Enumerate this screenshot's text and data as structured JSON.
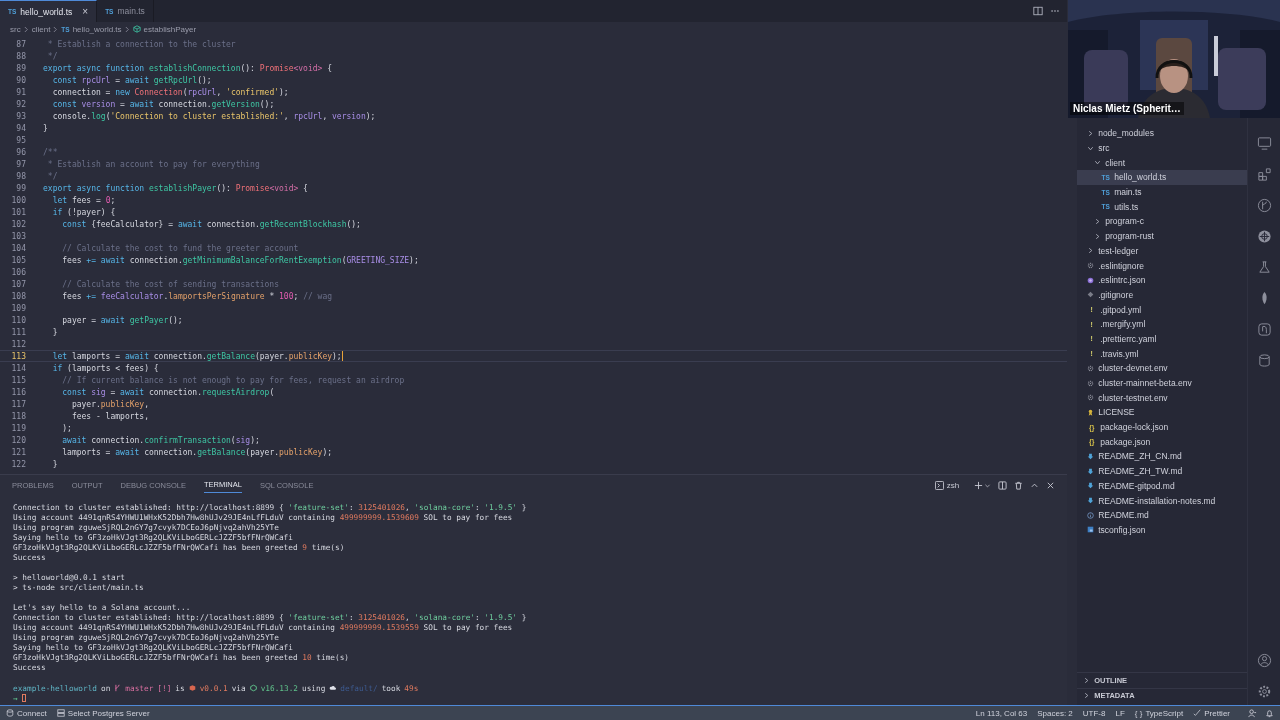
{
  "editor_tabs": [
    {
      "glyph": "TS",
      "label": "hello_world.ts",
      "selected": true,
      "close": "×"
    },
    {
      "glyph": "TS",
      "label": "main.ts",
      "selected": false
    }
  ],
  "breadcrumb": [
    {
      "kind": "folder",
      "text": "src"
    },
    {
      "kind": "folder",
      "text": "client"
    },
    {
      "kind": "file",
      "glyph": "TS",
      "text": "hello_world.ts"
    },
    {
      "kind": "symbol",
      "text": "establishPayer"
    }
  ],
  "code": [
    {
      "number": "87",
      "current": false,
      "tokens": [
        {
          "kind": "cm",
          "text": " * Establish a connection to the cluster"
        }
      ]
    },
    {
      "number": "88",
      "current": false,
      "tokens": [
        {
          "kind": "cm",
          "text": " */"
        }
      ]
    },
    {
      "number": "89",
      "current": false,
      "tokens": [
        {
          "kind": "kw",
          "text": "export async function "
        },
        {
          "kind": "fn",
          "text": "establishConnection"
        },
        {
          "kind": "plain",
          "text": "(): "
        },
        {
          "kind": "cls",
          "text": "Promise"
        },
        {
          "kind": "type",
          "text": "<void>"
        },
        {
          "kind": "plain",
          "text": " {"
        }
      ]
    },
    {
      "number": "90",
      "current": false,
      "tokens": [
        {
          "kind": "kw",
          "text": "  const "
        },
        {
          "kind": "var",
          "text": "rpcUrl"
        },
        {
          "kind": "plain",
          "text": " = "
        },
        {
          "kind": "kw",
          "text": "await "
        },
        {
          "kind": "fn",
          "text": "getRpcUrl"
        },
        {
          "kind": "plain",
          "text": "();"
        }
      ]
    },
    {
      "number": "91",
      "current": false,
      "tokens": [
        {
          "kind": "plain",
          "text": "  connection = "
        },
        {
          "kind": "kw",
          "text": "new "
        },
        {
          "kind": "cls",
          "text": "Connection"
        },
        {
          "kind": "plain",
          "text": "("
        },
        {
          "kind": "var",
          "text": "rpcUrl"
        },
        {
          "kind": "plain",
          "text": ", "
        },
        {
          "kind": "str",
          "text": "'confirmed'"
        },
        {
          "kind": "plain",
          "text": ");"
        }
      ]
    },
    {
      "number": "92",
      "current": false,
      "tokens": [
        {
          "kind": "kw",
          "text": "  const "
        },
        {
          "kind": "var",
          "text": "version"
        },
        {
          "kind": "plain",
          "text": " = "
        },
        {
          "kind": "kw",
          "text": "await "
        },
        {
          "kind": "plain",
          "text": "connection."
        },
        {
          "kind": "fn",
          "text": "getVersion"
        },
        {
          "kind": "plain",
          "text": "();"
        }
      ]
    },
    {
      "number": "93",
      "current": false,
      "tokens": [
        {
          "kind": "plain",
          "text": "  console."
        },
        {
          "kind": "fn",
          "text": "log"
        },
        {
          "kind": "plain",
          "text": "("
        },
        {
          "kind": "str",
          "text": "'Connection to cluster established:'"
        },
        {
          "kind": "plain",
          "text": ", "
        },
        {
          "kind": "var",
          "text": "rpcUrl"
        },
        {
          "kind": "plain",
          "text": ", "
        },
        {
          "kind": "var",
          "text": "version"
        },
        {
          "kind": "plain",
          "text": ");"
        }
      ]
    },
    {
      "number": "94",
      "current": false,
      "tokens": [
        {
          "kind": "plain",
          "text": "}"
        }
      ]
    },
    {
      "number": "95",
      "current": false
    },
    {
      "number": "96",
      "current": false,
      "tokens": [
        {
          "kind": "cm",
          "text": "/**"
        }
      ]
    },
    {
      "number": "97",
      "current": false,
      "tokens": [
        {
          "kind": "cm",
          "text": " * Establish an account to pay for everything"
        }
      ]
    },
    {
      "number": "98",
      "current": false,
      "tokens": [
        {
          "kind": "cm",
          "text": " */"
        }
      ]
    },
    {
      "number": "99",
      "current": false,
      "tokens": [
        {
          "kind": "kw",
          "text": "export async function "
        },
        {
          "kind": "fn",
          "text": "establishPayer"
        },
        {
          "kind": "plain",
          "text": "(): "
        },
        {
          "kind": "cls",
          "text": "Promise"
        },
        {
          "kind": "type",
          "text": "<void>"
        },
        {
          "kind": "plain",
          "text": " {"
        }
      ]
    },
    {
      "number": "100",
      "current": false,
      "tokens": [
        {
          "kind": "kw",
          "text": "  let "
        },
        {
          "kind": "plain",
          "text": "fees = "
        },
        {
          "kind": "num",
          "text": "0"
        },
        {
          "kind": "plain",
          "text": ";"
        }
      ]
    },
    {
      "number": "101",
      "current": false,
      "tokens": [
        {
          "kind": "kw",
          "text": "  if "
        },
        {
          "kind": "plain",
          "text": "(!payer) {"
        }
      ]
    },
    {
      "number": "102",
      "current": false,
      "tokens": [
        {
          "kind": "kw",
          "text": "    const "
        },
        {
          "kind": "plain",
          "text": "{feeCalculator} = "
        },
        {
          "kind": "kw",
          "text": "await "
        },
        {
          "kind": "plain",
          "text": "connection."
        },
        {
          "kind": "fn",
          "text": "getRecentBlockhash"
        },
        {
          "kind": "plain",
          "text": "();"
        }
      ]
    },
    {
      "number": "103",
      "current": false
    },
    {
      "number": "104",
      "current": false,
      "tokens": [
        {
          "kind": "cm",
          "text": "    // Calculate the cost to fund the greeter account"
        }
      ]
    },
    {
      "number": "105",
      "current": false,
      "tokens": [
        {
          "kind": "plain",
          "text": "    fees "
        },
        {
          "kind": "kw",
          "text": "+= await "
        },
        {
          "kind": "plain",
          "text": "connection."
        },
        {
          "kind": "fn",
          "text": "getMinimumBalanceForRentExemption"
        },
        {
          "kind": "plain",
          "text": "("
        },
        {
          "kind": "var",
          "text": "GREETING_SIZE"
        },
        {
          "kind": "plain",
          "text": ");"
        }
      ]
    },
    {
      "number": "106",
      "current": false
    },
    {
      "number": "107",
      "current": false,
      "tokens": [
        {
          "kind": "cm",
          "text": "    // Calculate the cost of sending transactions"
        }
      ]
    },
    {
      "number": "108",
      "current": false,
      "tokens": [
        {
          "kind": "plain",
          "text": "    fees "
        },
        {
          "kind": "kw",
          "text": "+= "
        },
        {
          "kind": "var",
          "text": "feeCalculator"
        },
        {
          "kind": "plain",
          "text": "."
        },
        {
          "kind": "prop",
          "text": "lamportsPerSignature"
        },
        {
          "kind": "plain",
          "text": " * "
        },
        {
          "kind": "num",
          "text": "100"
        },
        {
          "kind": "plain",
          "text": "; "
        },
        {
          "kind": "cm",
          "text": "// wag"
        }
      ]
    },
    {
      "number": "109",
      "current": false
    },
    {
      "number": "110",
      "current": false,
      "tokens": [
        {
          "kind": "plain",
          "text": "    payer = "
        },
        {
          "kind": "kw",
          "text": "await "
        },
        {
          "kind": "fn",
          "text": "getPayer"
        },
        {
          "kind": "plain",
          "text": "();"
        }
      ]
    },
    {
      "number": "111",
      "current": false,
      "tokens": [
        {
          "kind": "plain",
          "text": "  }"
        }
      ]
    },
    {
      "number": "112",
      "current": false
    },
    {
      "number": "113",
      "current": true,
      "tokens": [
        {
          "kind": "kw",
          "text": "  let "
        },
        {
          "kind": "plain",
          "text": "lamports = "
        },
        {
          "kind": "kw",
          "text": "await "
        },
        {
          "kind": "plain",
          "text": "connection."
        },
        {
          "kind": "fn",
          "text": "getBalance"
        },
        {
          "kind": "plain",
          "text": "(payer."
        },
        {
          "kind": "prop",
          "text": "publicKey"
        },
        {
          "kind": "plain",
          "text": ");"
        }
      ]
    },
    {
      "number": "114",
      "current": false,
      "tokens": [
        {
          "kind": "kw",
          "text": "  if "
        },
        {
          "kind": "plain",
          "text": "(lamports < fees) {"
        }
      ]
    },
    {
      "number": "115",
      "current": false,
      "tokens": [
        {
          "kind": "cm",
          "text": "    // If current balance is not enough to pay for fees, request an airdrop"
        }
      ]
    },
    {
      "number": "116",
      "current": false,
      "tokens": [
        {
          "kind": "kw",
          "text": "    const "
        },
        {
          "kind": "var",
          "text": "sig"
        },
        {
          "kind": "plain",
          "text": " = "
        },
        {
          "kind": "kw",
          "text": "await "
        },
        {
          "kind": "plain",
          "text": "connection."
        },
        {
          "kind": "fn",
          "text": "requestAirdrop"
        },
        {
          "kind": "plain",
          "text": "("
        }
      ]
    },
    {
      "number": "117",
      "current": false,
      "tokens": [
        {
          "kind": "plain",
          "text": "      payer."
        },
        {
          "kind": "prop",
          "text": "publicKey"
        },
        {
          "kind": "plain",
          "text": ","
        }
      ]
    },
    {
      "number": "118",
      "current": false,
      "tokens": [
        {
          "kind": "plain",
          "text": "      fees - lamports,"
        }
      ]
    },
    {
      "number": "119",
      "current": false,
      "tokens": [
        {
          "kind": "plain",
          "text": "    );"
        }
      ]
    },
    {
      "number": "120",
      "current": false,
      "tokens": [
        {
          "kind": "kw",
          "text": "    await "
        },
        {
          "kind": "plain",
          "text": "connection."
        },
        {
          "kind": "fn",
          "text": "confirmTransaction"
        },
        {
          "kind": "plain",
          "text": "("
        },
        {
          "kind": "var",
          "text": "sig"
        },
        {
          "kind": "plain",
          "text": ");"
        }
      ]
    },
    {
      "number": "121",
      "current": false,
      "tokens": [
        {
          "kind": "plain",
          "text": "    lamports = "
        },
        {
          "kind": "kw",
          "text": "await "
        },
        {
          "kind": "plain",
          "text": "connection."
        },
        {
          "kind": "fn",
          "text": "getBalance"
        },
        {
          "kind": "plain",
          "text": "(payer."
        },
        {
          "kind": "prop",
          "text": "publicKey"
        },
        {
          "kind": "plain",
          "text": ");"
        }
      ]
    },
    {
      "number": "122",
      "current": false,
      "tokens": [
        {
          "kind": "plain",
          "text": "  }"
        }
      ]
    }
  ],
  "panel": {
    "tabs": [
      {
        "label": "PROBLEMS",
        "selected": false
      },
      {
        "label": "OUTPUT",
        "selected": false
      },
      {
        "label": "DEBUG CONSOLE",
        "selected": false
      },
      {
        "label": "TERMINAL",
        "selected": true
      },
      {
        "label": "SQL CONSOLE",
        "selected": false
      }
    ],
    "shell": "zsh",
    "terminal_blocks": [
      {
        "lines": [
          {
            "tokens": [
              {
                "kind": "text",
                "text": "Connection to cluster established: http://localhost:8899 { "
              },
              {
                "kind": "string",
                "text": "'feature-set'"
              },
              {
                "kind": "text",
                "text": ": "
              },
              {
                "kind": "number",
                "text": "3125401026"
              },
              {
                "kind": "text",
                "text": ", "
              },
              {
                "kind": "string",
                "text": "'solana-core'"
              },
              {
                "kind": "text",
                "text": ": "
              },
              {
                "kind": "string",
                "text": "'1.9.5'"
              },
              {
                "kind": "text",
                "text": " }"
              }
            ]
          },
          {
            "tokens": [
              {
                "kind": "text",
                "text": "Using account 4491qnRS4YHWU1WHxK52Dbh7Hw8hUJv29JE4nLfFLduV containing "
              },
              {
                "kind": "number",
                "text": "499999999.1539609"
              },
              {
                "kind": "text",
                "text": " SOL to pay for fees"
              }
            ]
          },
          {
            "tokens": [
              {
                "kind": "text",
                "text": "Using program zguweSjRQL2nGY7g7cvyk7DCEoJ6pNjvq2ahVh25YTe"
              }
            ]
          },
          {
            "tokens": [
              {
                "kind": "text",
                "text": "Saying hello to GF3zoHkVJgt3Rg2QLKViLboGERLcJZZF5bfFNrQWCafi"
              }
            ]
          },
          {
            "tokens": [
              {
                "kind": "text",
                "text": "GF3zoHkVJgt3Rg2QLKViLboGERLcJZZF5bfFNrQWCafi has been greeted "
              },
              {
                "kind": "number",
                "text": "9"
              },
              {
                "kind": "text",
                "text": " time(s)"
              }
            ]
          },
          {
            "tokens": [
              {
                "kind": "text",
                "text": "Success"
              }
            ]
          }
        ]
      },
      {
        "lines": [
          {
            "tokens": [
              {
                "kind": "text",
                "text": "> helloworld@0.0.1 start"
              }
            ]
          },
          {
            "tokens": [
              {
                "kind": "text",
                "text": "> ts-node src/client/main.ts"
              }
            ]
          }
        ]
      },
      {
        "lines": [
          {
            "tokens": [
              {
                "kind": "text",
                "text": "Let's say hello to a Solana account..."
              }
            ]
          },
          {
            "tokens": [
              {
                "kind": "text",
                "text": "Connection to cluster established: http://localhost:8899 { "
              },
              {
                "kind": "string",
                "text": "'feature-set'"
              },
              {
                "kind": "text",
                "text": ": "
              },
              {
                "kind": "number",
                "text": "3125401026"
              },
              {
                "kind": "text",
                "text": ", "
              },
              {
                "kind": "string",
                "text": "'solana-core'"
              },
              {
                "kind": "text",
                "text": ": "
              },
              {
                "kind": "string",
                "text": "'1.9.5'"
              },
              {
                "kind": "text",
                "text": " }"
              }
            ]
          },
          {
            "tokens": [
              {
                "kind": "text",
                "text": "Using account 4491qnRS4YHWU1WHxK52Dbh7Hw8hUJv29JE4nLfFLduV containing "
              },
              {
                "kind": "number",
                "text": "499999999.1539559"
              },
              {
                "kind": "text",
                "text": " SOL to pay for fees"
              }
            ]
          },
          {
            "tokens": [
              {
                "kind": "text",
                "text": "Using program zguweSjRQL2nGY7g7cvyk7DCEoJ6pNjvq2ahVh25YTe"
              }
            ]
          },
          {
            "tokens": [
              {
                "kind": "text",
                "text": "Saying hello to GF3zoHkVJgt3Rg2QLKViLboGERLcJZZF5bfFNrQWCafi"
              }
            ]
          },
          {
            "tokens": [
              {
                "kind": "text",
                "text": "GF3zoHkVJgt3Rg2QLKViLboGERLcJZZF5bfFNrQWCafi has been greeted "
              },
              {
                "kind": "number",
                "text": "10"
              },
              {
                "kind": "text",
                "text": " time(s)"
              }
            ]
          },
          {
            "tokens": [
              {
                "kind": "text",
                "text": "Success"
              }
            ]
          }
        ]
      }
    ],
    "prompt": {
      "directory": "example-helloworld",
      "on": "on",
      "branch": "master",
      "branch_status": "[!]",
      "is": "is",
      "version": "v0.0.1",
      "via": "via",
      "node": "v16.13.2",
      "using": "using",
      "profile": "default/",
      "took": "took",
      "duration": "49s",
      "symbol": "→"
    }
  },
  "explorer": {
    "items": [
      {
        "kind": "folder",
        "name": "node_modules",
        "expanded": false,
        "selected": false
      },
      {
        "kind": "folder",
        "name": "src",
        "expanded": true,
        "selected": false,
        "children": [
          {
            "kind": "folder",
            "name": "client",
            "expanded": true,
            "selected": false,
            "children": [
              {
                "kind": "ts",
                "glyph": "TS",
                "name": "hello_world.ts",
                "selected": true
              },
              {
                "kind": "ts",
                "glyph": "TS",
                "name": "main.ts",
                "selected": false
              },
              {
                "kind": "ts",
                "glyph": "TS",
                "name": "utils.ts",
                "selected": false
              }
            ]
          },
          {
            "kind": "folder",
            "name": "program-c",
            "expanded": false,
            "selected": false
          },
          {
            "kind": "folder",
            "name": "program-rust",
            "expanded": false,
            "selected": false
          }
        ]
      },
      {
        "kind": "folder",
        "name": "test-ledger",
        "expanded": false,
        "selected": false
      },
      {
        "kind": "config",
        "name": ".eslintignore",
        "selected": false
      },
      {
        "kind": "eslint",
        "name": ".eslintrc.json",
        "selected": false
      },
      {
        "kind": "git",
        "name": ".gitignore",
        "selected": false
      },
      {
        "kind": "yaml",
        "glyph": "!",
        "name": ".gitpod.yml",
        "selected": false
      },
      {
        "kind": "yaml",
        "glyph": "!",
        "name": ".mergify.yml",
        "selected": false
      },
      {
        "kind": "yaml",
        "glyph": "!",
        "name": ".prettierrc.yaml",
        "selected": false
      },
      {
        "kind": "yaml",
        "glyph": "!",
        "name": ".travis.yml",
        "selected": false
      },
      {
        "kind": "config",
        "name": "cluster-devnet.env",
        "selected": false
      },
      {
        "kind": "config",
        "name": "cluster-mainnet-beta.env",
        "selected": false
      },
      {
        "kind": "config",
        "name": "cluster-testnet.env",
        "selected": false
      },
      {
        "kind": "license",
        "name": "LICENSE",
        "selected": false
      },
      {
        "kind": "json",
        "glyph": "{}",
        "name": "package-lock.json",
        "selected": false
      },
      {
        "kind": "json",
        "glyph": "{}",
        "name": "package.json",
        "selected": false
      },
      {
        "kind": "markdown",
        "name": "README_ZH_CN.md",
        "selected": false
      },
      {
        "kind": "markdown",
        "name": "README_ZH_TW.md",
        "selected": false
      },
      {
        "kind": "markdown",
        "name": "README-gitpod.md",
        "selected": false
      },
      {
        "kind": "markdown",
        "name": "README-installation-notes.md",
        "selected": false
      },
      {
        "kind": "readme",
        "name": "README.md",
        "selected": false
      },
      {
        "kind": "tsconfig",
        "name": "tsconfig.json",
        "selected": false
      }
    ],
    "sections": [
      {
        "title": "OUTLINE",
        "expanded": false
      },
      {
        "title": "METADATA",
        "expanded": false
      }
    ]
  },
  "webcam": {
    "kind": "picture",
    "name": "Niclas Mietz (Spherit…"
  },
  "status_bar": {
    "left": [
      {
        "kind": "database",
        "text": "Connect"
      },
      {
        "kind": "server",
        "text": "Select Postgres Server"
      }
    ],
    "right": [
      {
        "kind": "text",
        "text": "Ln 113, Col 63"
      },
      {
        "kind": "text",
        "text": "Spaces: 2"
      },
      {
        "kind": "text",
        "text": "UTF-8"
      },
      {
        "kind": "text",
        "text": "LF"
      },
      {
        "kind": "glyph",
        "glyph": "{ }",
        "text": "TypeScript"
      },
      {
        "kind": "check",
        "text": "Prettier"
      }
    ]
  }
}
